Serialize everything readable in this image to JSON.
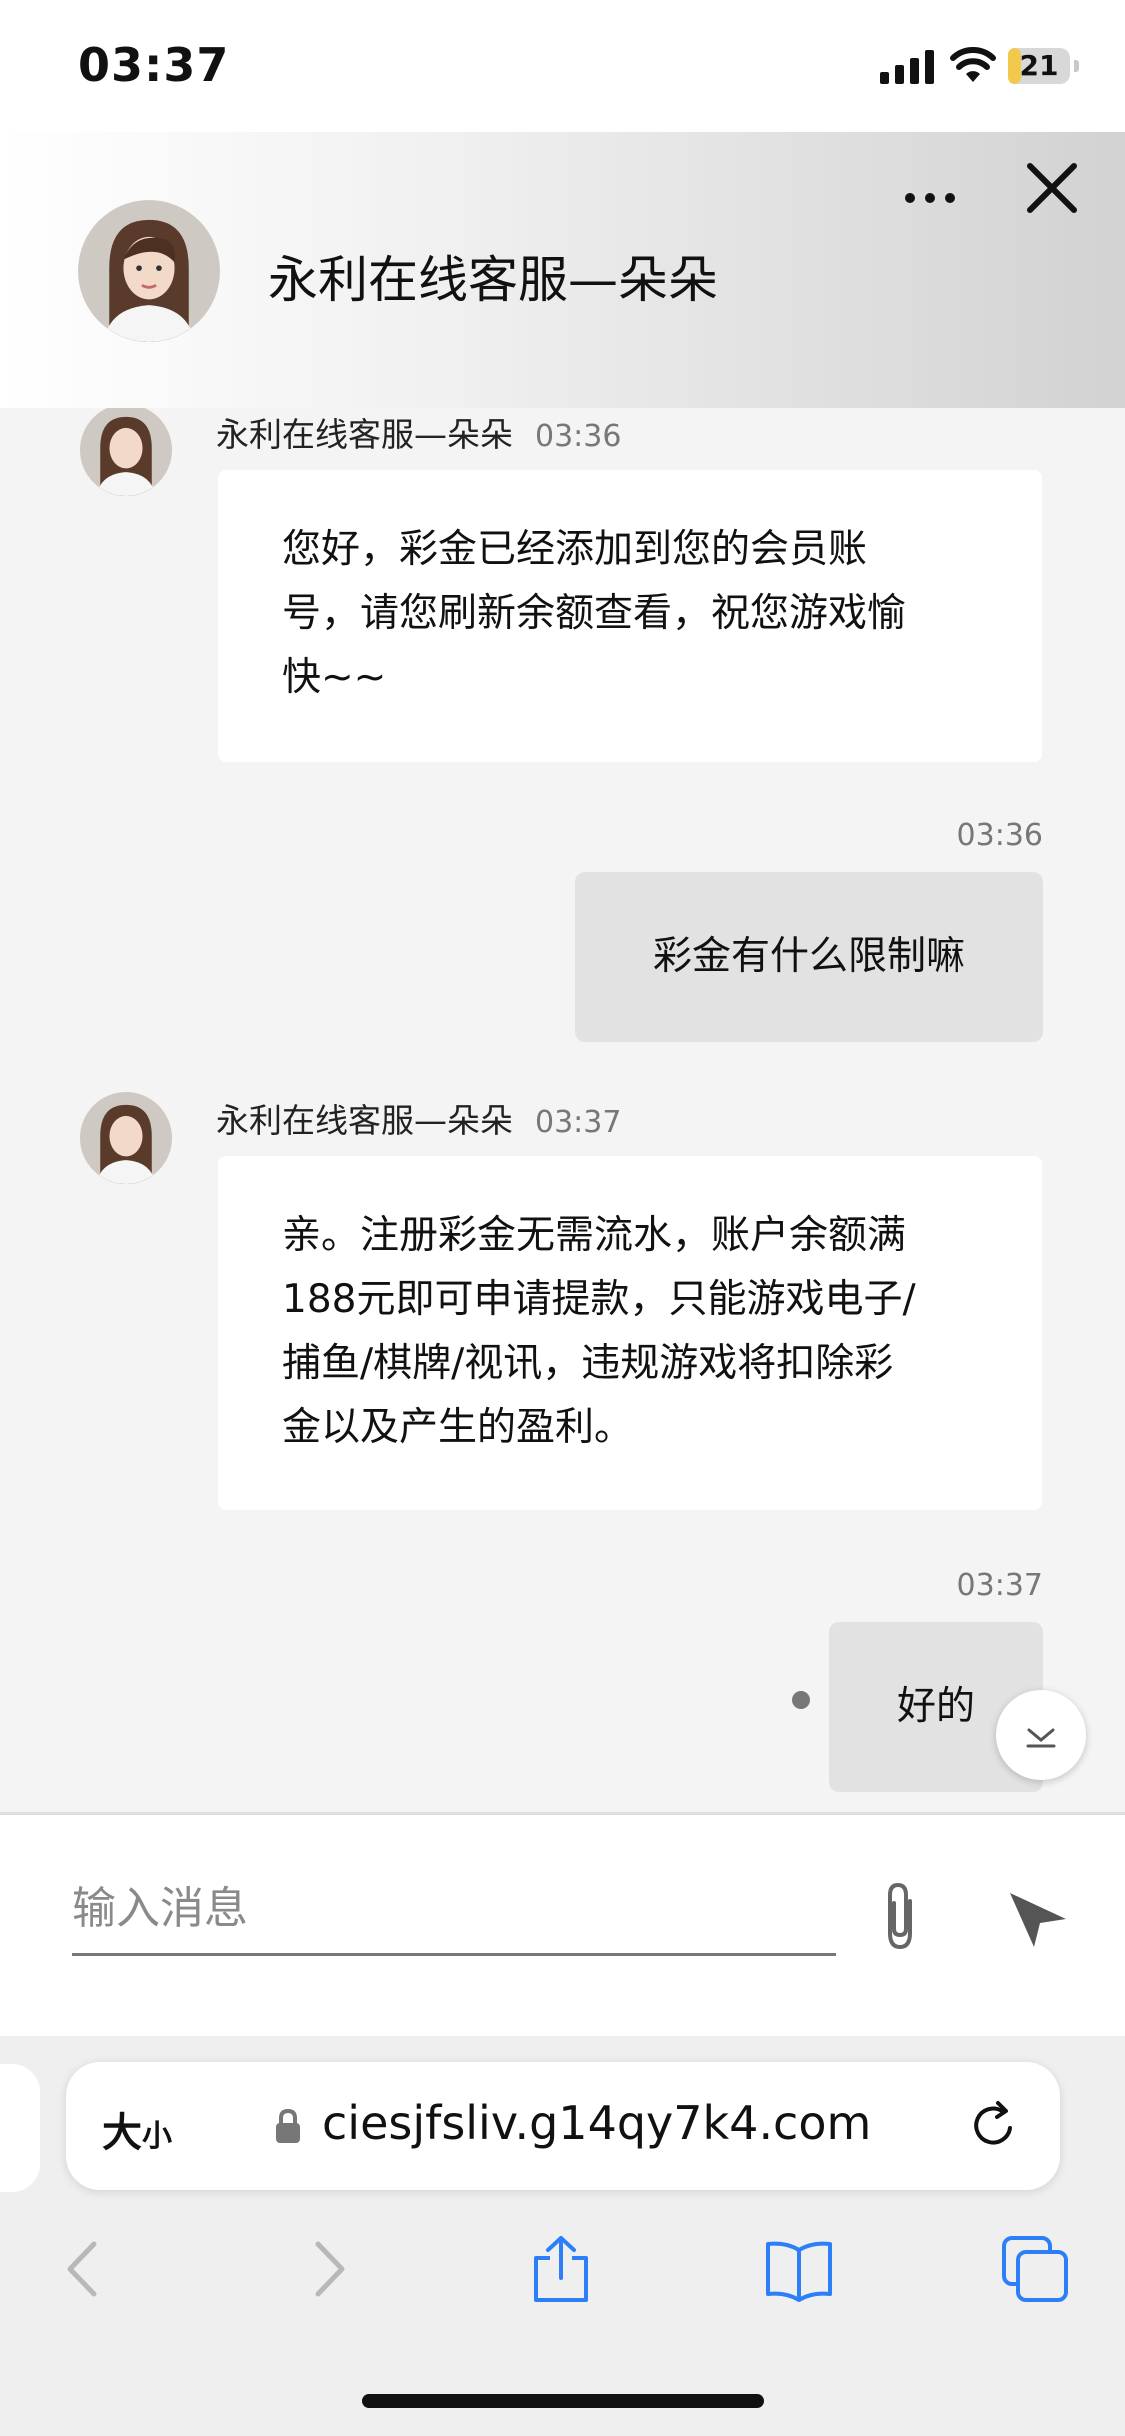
{
  "status_bar": {
    "time": "03:37",
    "battery": "21",
    "battery_level": 0.21
  },
  "header": {
    "title": "永利在线客服—朵朵"
  },
  "messages": [
    {
      "sender": "永利在线客服—朵朵",
      "time": "03:36",
      "lines": [
        "您好，彩金已经添加到您的会员账",
        "号，请您刷新余额查看，祝您游戏愉",
        "快~~"
      ]
    },
    {
      "time": "03:36",
      "text": "彩金有什么限制嘛"
    },
    {
      "sender": "永利在线客服—朵朵",
      "time": "03:37",
      "lines": [
        "亲。注册彩金无需流水，账户余额满",
        "188元即可申请提款，只能游戏电子/",
        "捕鱼/棋牌/视讯，违规游戏将扣除彩",
        "金以及产生的盈利。"
      ]
    },
    {
      "time": "03:37",
      "text": "好的"
    }
  ],
  "input": {
    "placeholder": "输入消息"
  },
  "browser": {
    "text_size_big": "大",
    "text_size_small": "小",
    "url": "ciesjfsliv.g14qy7k4.com"
  },
  "colors": {
    "accent": "#2d7ff9",
    "outgoing_bubble": "#e2e2e2",
    "incoming_bubble": "#ffffff"
  }
}
